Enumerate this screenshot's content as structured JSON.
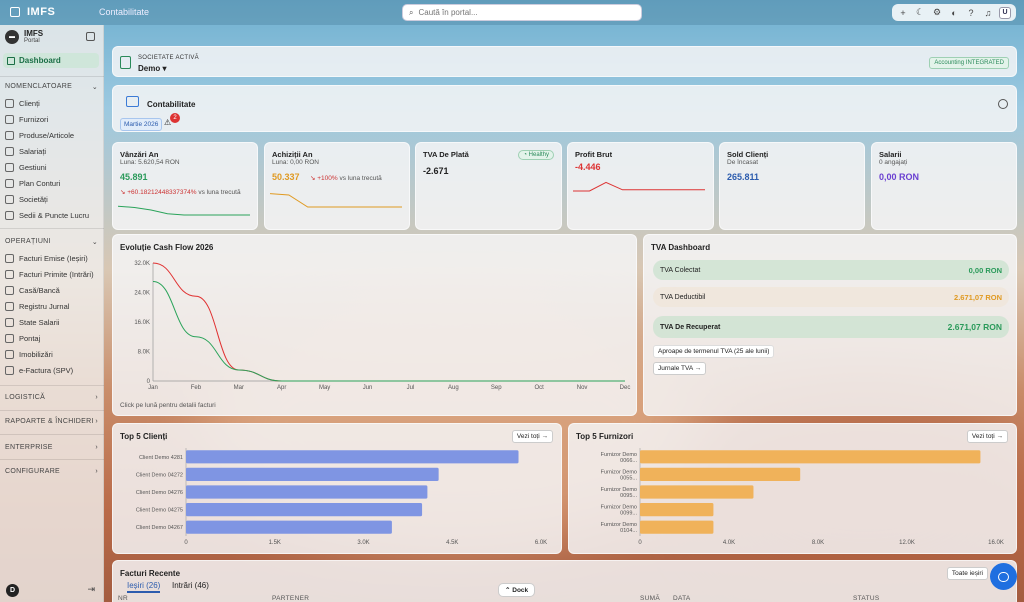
{
  "topbar": {
    "logo": "IMFS",
    "breadcrumb": "Contabilitate",
    "search_placeholder": "Caută în portal..."
  },
  "sidebar": {
    "brand_name": "IMFS",
    "brand_sub": "Portal",
    "dashboard": "Dashboard",
    "section_nomenclatoare": "NOMENCLATOARE",
    "nomenclatoare": [
      "Clienți",
      "Furnizori",
      "Produse/Articole",
      "Salariați",
      "Gestiuni",
      "Plan Conturi",
      "Societăți",
      "Sedii & Puncte Lucru"
    ],
    "section_operatiuni": "OPERAȚIUNI",
    "operatiuni": [
      "Facturi Emise (Ieșiri)",
      "Facturi Primite (Intrări)",
      "Casă/Bancă",
      "Registru Jurnal",
      "State Salarii",
      "Pontaj",
      "Imobilizări",
      "e-Factura (SPV)"
    ],
    "section_logistica": "LOGISTICĂ",
    "section_rapoarte": "RAPOARTE & ÎNCHIDERI",
    "section_enterprise": "ENTERPRISE",
    "section_configurare": "CONFIGURARE",
    "user_initial": "D"
  },
  "company": {
    "label": "SOCIETATE ACTIVĂ",
    "value": "Demo",
    "badge": "Accounting INTEGRATED"
  },
  "contabilitate": {
    "title": "Contabilitate",
    "month": "Martie 2026",
    "notifications": "2"
  },
  "kpis": [
    {
      "title": "Vânzări An",
      "sub": "Luna: 5.620,54 RON",
      "value": "45.891",
      "value_color": "#2a9a5a",
      "delta": "+60.18212448337374%",
      "delta_rest": "vs luna trecută",
      "trend": [
        9,
        10,
        12,
        15,
        16,
        16,
        16,
        16,
        16
      ]
    },
    {
      "title": "Achiziții An",
      "sub": "Luna: 0,00 RON",
      "value": "50.337",
      "value_color": "#e09a22",
      "delta": "+100%",
      "delta_rest": "vs luna trecută",
      "trend": [
        2,
        3,
        12,
        12,
        12,
        12,
        12,
        12
      ]
    },
    {
      "title": "TVA De Plată",
      "badge": "Healthy",
      "value": "-2.671",
      "value_color": "#2a9a5a"
    },
    {
      "title": "Profit Brut",
      "value": "-4.446",
      "value_color": "#d33",
      "trend": [
        13,
        13,
        6,
        12,
        12,
        12,
        12,
        12,
        12
      ]
    },
    {
      "title": "Sold Clienți",
      "sub": "De încasat",
      "value": "265.811",
      "value_color": "#2c5cae"
    },
    {
      "title": "Salarii",
      "sub": "0 angajați",
      "value": "0,00 RON",
      "value_color": "#6a3fd1"
    }
  ],
  "cashflow": {
    "title": "Evoluție Cash Flow 2026",
    "hint": "Click pe lună pentru detalii facturi",
    "chart_data": {
      "type": "line",
      "x": [
        "Jan",
        "Feb",
        "Mar",
        "Apr",
        "May",
        "Jun",
        "Jul",
        "Aug",
        "Sep",
        "Oct",
        "Nov",
        "Dec"
      ],
      "yticks": [
        "32.0K",
        "24.0K",
        "16.0K",
        "8.0K",
        "0"
      ],
      "ylim": [
        0,
        32000
      ],
      "series": [
        {
          "color": "#e03030",
          "values": [
            32000,
            23000,
            3000,
            0,
            0,
            0,
            0,
            0,
            0,
            0,
            0,
            0
          ]
        },
        {
          "color": "#2aa35a",
          "values": [
            27000,
            12000,
            3000,
            0,
            0,
            0,
            0,
            0,
            0,
            0,
            0,
            0
          ]
        }
      ]
    }
  },
  "tva": {
    "title": "TVA Dashboard",
    "rows": [
      {
        "label": "TVA Colectat",
        "value": "0,00 RON",
        "color": "#2a9a5a",
        "bg": "rgba(200,225,205,.7)"
      },
      {
        "label": "TVA Deductibil",
        "value": "2.671,07 RON",
        "color": "#e09a22",
        "bg": "rgba(240,230,215,.7)"
      },
      {
        "label": "TVA De Recuperat",
        "value": "2.671,07 RON",
        "color": "#2a9a5a",
        "bg": "rgba(200,225,205,.7)"
      }
    ],
    "tip": "Aproape de termenul TVA (25 ale lunii)",
    "button": "Jurnale TVA →"
  },
  "top_clients": {
    "title": "Top 5 Clienți",
    "more": "Vezi toți →",
    "chart_data": {
      "type": "bar",
      "categories": [
        "Client Demo 4281",
        "Client Demo 04272",
        "Client Demo 04276",
        "Client Demo 04275",
        "Client Demo 04267"
      ],
      "values": [
        5620,
        4270,
        4080,
        3990,
        3480
      ],
      "xticks": [
        "0",
        "1.5K",
        "3.0K",
        "4.5K",
        "6.0K"
      ],
      "xlim": [
        0,
        6000
      ]
    }
  },
  "top_suppliers": {
    "title": "Top 5 Furnizori",
    "more": "Vezi toți →",
    "chart_data": {
      "type": "bar",
      "categories": [
        "Furnizor Demo 0066...",
        "Furnizor Demo 0055...",
        "Furnizor Demo 0095...",
        "Furnizor Demo 0099...",
        "Furnizor Demo 0104..."
      ],
      "values": [
        15300,
        7200,
        5100,
        3300,
        3300
      ],
      "xticks": [
        "0",
        "4.0K",
        "8.0K",
        "12.0K",
        "16.0K"
      ],
      "xlim": [
        0,
        16000
      ]
    }
  },
  "invoices": {
    "title": "Facturi Recente",
    "tab_out": "Ieșiri (26)",
    "tab_in": "Intrări (46)",
    "more": "Toate ieșiri",
    "headers": [
      "NR",
      "PARTENER",
      "SUMĂ",
      "DATA",
      "STATUS"
    ]
  },
  "dock": "⌃ Dock"
}
